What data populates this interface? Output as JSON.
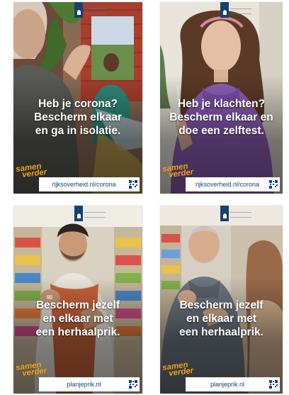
{
  "colors": {
    "rijksoverheid_blue": "#154273",
    "samen_verder_orange": "#f5a31a",
    "message_text": "#ffffff"
  },
  "posters": [
    {
      "message_lines": [
        "Heb je corona?",
        "Bescherm elkaar",
        "en ga in isolatie."
      ],
      "brand_lines": [
        "samen",
        "verder"
      ],
      "url": "rijksoverheid.nl/corona",
      "logo_icon": "rijksoverheid-lion-icon",
      "qr_icon": "qr-code-icon"
    },
    {
      "message_lines": [
        "Heb je klachten?",
        "Bescherm elkaar en",
        "doe een zelftest."
      ],
      "brand_lines": [
        "samen",
        "verder"
      ],
      "url": "rijksoverheid.nl/corona",
      "logo_icon": "rijksoverheid-lion-icon",
      "qr_icon": "qr-code-icon"
    },
    {
      "message_lines": [
        "Bescherm jezelf",
        "en elkaar met",
        "een herhaalprik."
      ],
      "brand_lines": [
        "samen",
        "verder"
      ],
      "url": "planjeprik.nl",
      "logo_icon": "rijksoverheid-lion-icon",
      "qr_icon": "qr-code-icon"
    },
    {
      "message_lines": [
        "Bescherm jezelf",
        "en elkaar met",
        "een herhaalprik."
      ],
      "brand_lines": [
        "samen",
        "verder"
      ],
      "url": "planjeprik.nl",
      "logo_icon": "rijksoverheid-lion-icon",
      "qr_icon": "qr-code-icon"
    }
  ]
}
